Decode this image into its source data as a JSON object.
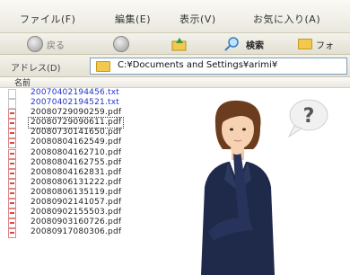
{
  "menu": [
    "ファイル(F)",
    "編集(E)",
    "表示(V)",
    "お気に入り(A)"
  ],
  "toolbar": {
    "back_label": "戻る",
    "search_label": "検索",
    "folders_label": "フォ"
  },
  "address": {
    "label": "アドレス(D)",
    "path": "C:¥Documents and Settings¥arimi¥"
  },
  "list_header": "名前",
  "files": [
    {
      "name": "20070402194456.txt",
      "type": "txt"
    },
    {
      "name": "20070402194521.txt",
      "type": "txt"
    },
    {
      "name": "20080729090259.pdf",
      "type": "pdf"
    },
    {
      "name": "20080729090611.pdf",
      "type": "pdf",
      "selected": true
    },
    {
      "name": "20080730141650.pdf",
      "type": "pdf"
    },
    {
      "name": "20080804162549.pdf",
      "type": "pdf"
    },
    {
      "name": "20080804162710.pdf",
      "type": "pdf"
    },
    {
      "name": "20080804162755.pdf",
      "type": "pdf"
    },
    {
      "name": "20080804162831.pdf",
      "type": "pdf"
    },
    {
      "name": "20080806131222.pdf",
      "type": "pdf"
    },
    {
      "name": "20080806135119.pdf",
      "type": "pdf"
    },
    {
      "name": "20080902141057.pdf",
      "type": "pdf"
    },
    {
      "name": "20080902155503.pdf",
      "type": "pdf"
    },
    {
      "name": "20080903160726.pdf",
      "type": "pdf"
    },
    {
      "name": "20080917080306.pdf",
      "type": "pdf"
    }
  ],
  "bubble_text": "?"
}
